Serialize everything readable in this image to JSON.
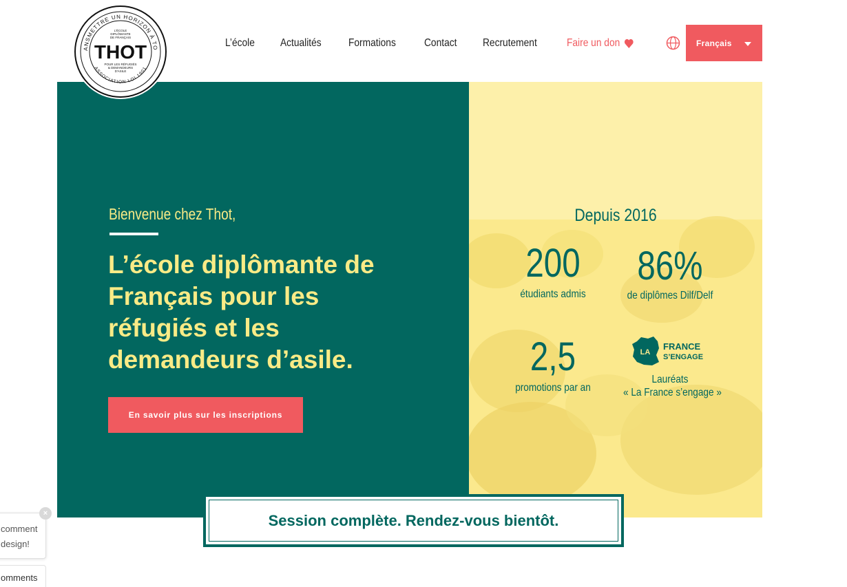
{
  "logo": {
    "ring_text": "TRANSMETTRE UN HORIZON À TOUS",
    "bottom_text": "ASSOCIATION LOI 1901",
    "top_lines": [
      "L'ÉCOLE",
      "DIPLÔMANTE",
      "DE FRANÇAIS"
    ],
    "wordmark": "THOT",
    "bottom_lines": [
      "POUR LES RÉFUGIÉS",
      "& DEMANDEURS",
      "D'ASILE"
    ]
  },
  "nav": {
    "items": [
      "L’école",
      "Actualités",
      "Formations",
      "Contact",
      "Recrutement"
    ],
    "don_label": "Faire un don"
  },
  "language": {
    "selected": "Français"
  },
  "hero": {
    "welcome": "Bienvenue chez Thot,",
    "headline": "L’école diplômante de Français pour les réfugiés et les demandeurs d’asile.",
    "cta_label": "En savoir plus sur les inscriptions"
  },
  "stats": {
    "since": "Depuis 2016",
    "students_value": "200",
    "students_label": "étudiants admis",
    "diplomas_value": "86%",
    "diplomas_label": "de diplômes Dilf/Delf",
    "promotions_value": "2,5",
    "promotions_label": "promotions par an",
    "award_logo_text": [
      "LA",
      "FRANCE",
      "S’ENGAGE"
    ],
    "award_line1": "Lauréats",
    "award_line2": "« La France s’engage »"
  },
  "session_banner": "Session complète. Rendez-vous bientôt.",
  "comment_widget": {
    "line1": "comment",
    "line2": "design!",
    "close": "×",
    "button_label": "omments"
  },
  "colors": {
    "teal": "#02675f",
    "coral": "#f05a5f",
    "yellow": "#f9eb86"
  }
}
